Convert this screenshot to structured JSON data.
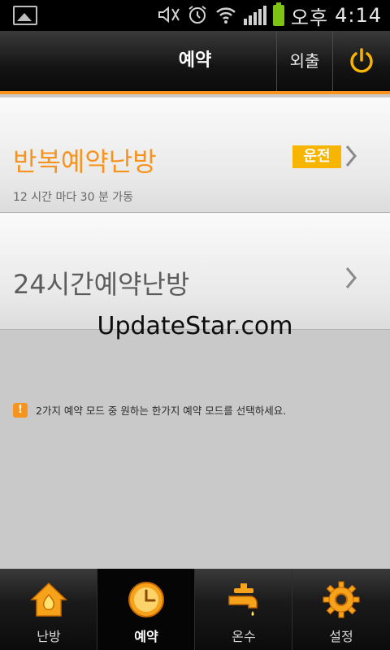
{
  "status_bar": {
    "time": "4:14",
    "ampm": "오후",
    "icons": [
      "gallery-icon",
      "mute-icon",
      "alarm-icon",
      "wifi-icon",
      "signal-icon",
      "battery-icon"
    ]
  },
  "header": {
    "title": "예약",
    "outing_label": "외출",
    "power_icon": "power-icon"
  },
  "rows": [
    {
      "name": "반복예약난방",
      "sub": "12 시간 마다 30 분 가동",
      "badge": "운전"
    },
    {
      "name": "24시간예약난방"
    }
  ],
  "watermark": "UpdateStar.com",
  "notice": {
    "icon": "!",
    "text": "2가지 예약 모드 중 원하는 한가지 예약 모드를 선택하세요."
  },
  "bottom_nav": {
    "tabs": [
      {
        "label": "난방",
        "icon": "house-flame-icon",
        "active": false
      },
      {
        "label": "예약",
        "icon": "clock-icon",
        "active": true
      },
      {
        "label": "온수",
        "icon": "faucet-icon",
        "active": false
      },
      {
        "label": "설정",
        "icon": "gear-icon",
        "active": false
      }
    ]
  },
  "colors": {
    "accent": "#f7941d",
    "badge": "#f7b500",
    "header_bg": "#141414"
  }
}
